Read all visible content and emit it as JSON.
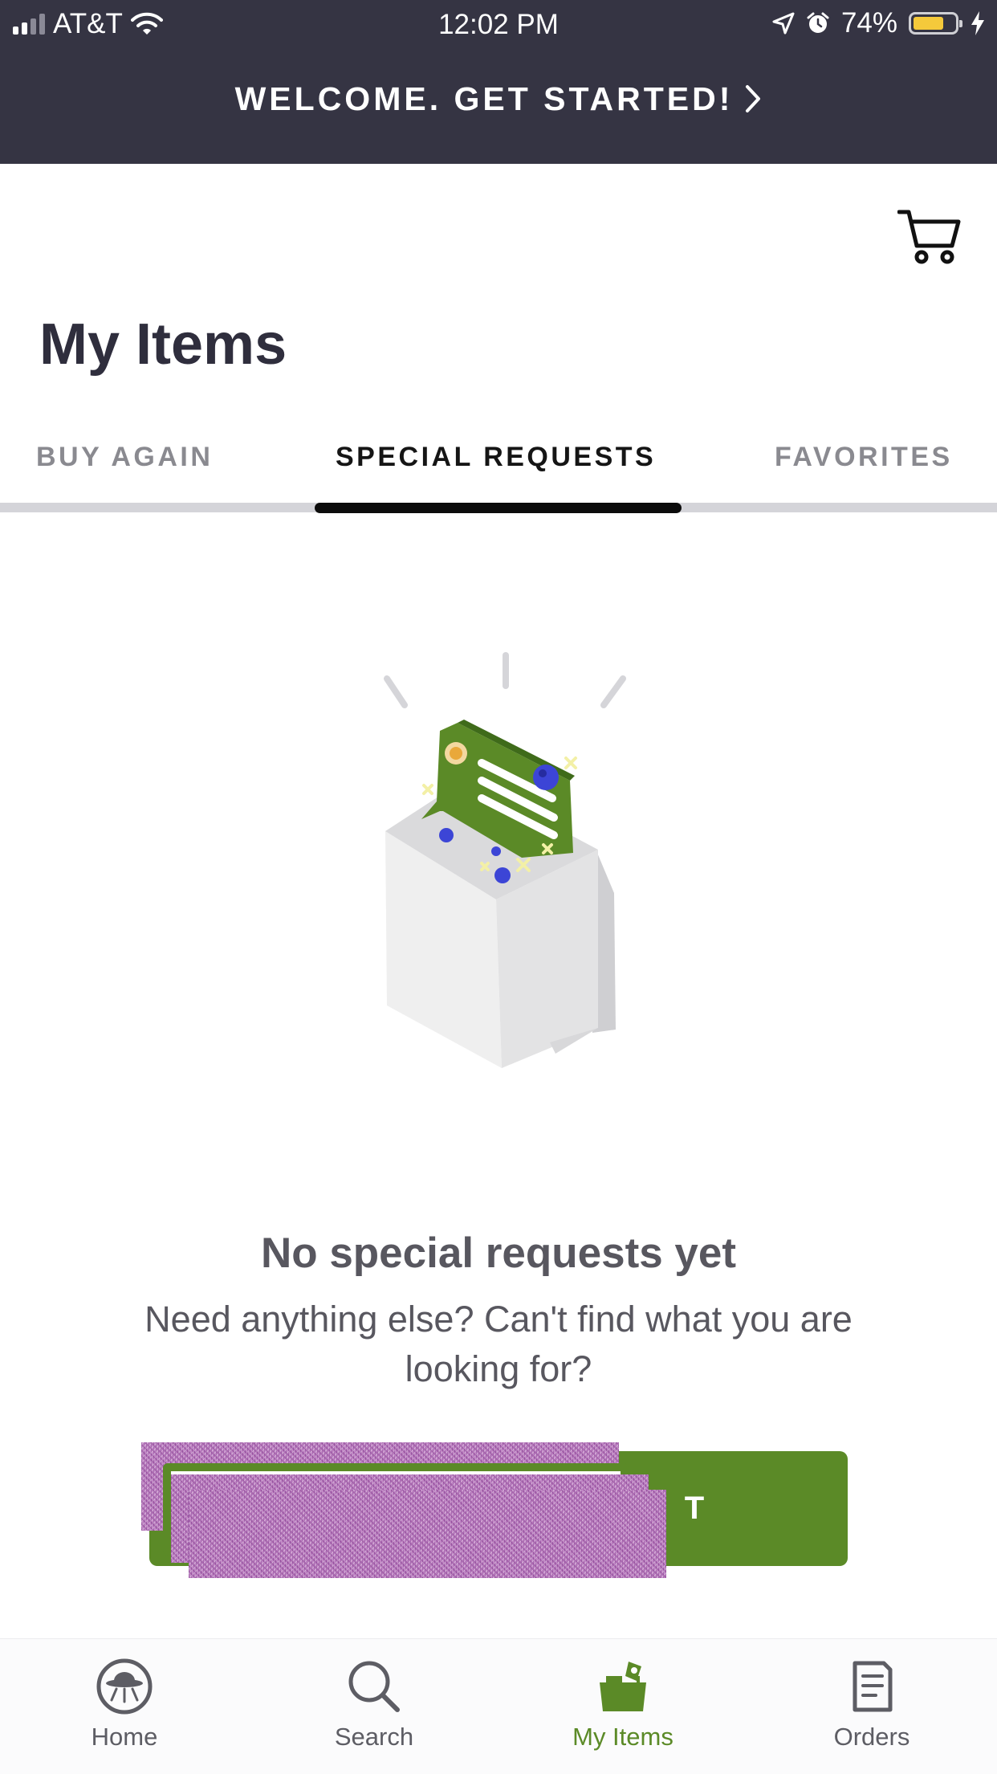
{
  "status_bar": {
    "carrier": "AT&T",
    "time": "12:02 PM",
    "battery_percent": "74%",
    "battery_level": 0.74,
    "battery_color": "#f5c93b"
  },
  "banner": {
    "text": "WELCOME. GET STARTED!",
    "icon": "chevron-right-icon"
  },
  "header": {
    "cart_icon": "cart-icon",
    "title": "My Items"
  },
  "tabs": [
    {
      "label": "BUY AGAIN",
      "active": false
    },
    {
      "label": "SPECIAL REQUESTS",
      "active": true
    },
    {
      "label": "FAVORITES",
      "active": false
    }
  ],
  "empty_state": {
    "illustration": "shopping-bag-with-note-illustration",
    "title": "No special requests yet",
    "body": "Need anything else? Can't find what you are looking for?",
    "button_visible_text": "T"
  },
  "bottom_nav": [
    {
      "label": "Home",
      "icon": "ufo-home-icon",
      "active": false
    },
    {
      "label": "Search",
      "icon": "search-icon",
      "active": false
    },
    {
      "label": "My Items",
      "icon": "basket-icon",
      "active": true
    },
    {
      "label": "Orders",
      "icon": "receipt-icon",
      "active": false
    }
  ],
  "colors": {
    "header_bg": "#353443",
    "brand_green": "#5b8a27",
    "title_text": "#2f2e3d"
  }
}
